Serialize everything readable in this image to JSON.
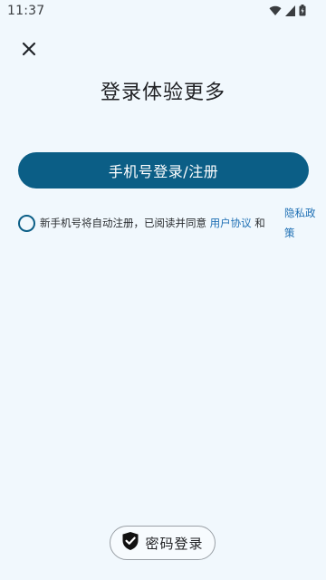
{
  "status_bar": {
    "time": "11:37",
    "icons": [
      "wifi-icon",
      "signal-icon",
      "battery-icon"
    ]
  },
  "header": {
    "close_icon": "close-icon"
  },
  "main": {
    "title": "登录体验更多",
    "primary_button": "手机号登录/注册"
  },
  "agreement": {
    "text": "新手机号将自动注册，已阅读并同意 ",
    "user_agreement": "用户协议",
    "and": " 和",
    "privacy_policy": "隐私政策"
  },
  "footer": {
    "password_login": "密码登录",
    "icon": "shield-check-icon"
  },
  "colors": {
    "background": "#f1f8fd",
    "primary": "#0b5e86",
    "link": "#1e6fb4"
  }
}
